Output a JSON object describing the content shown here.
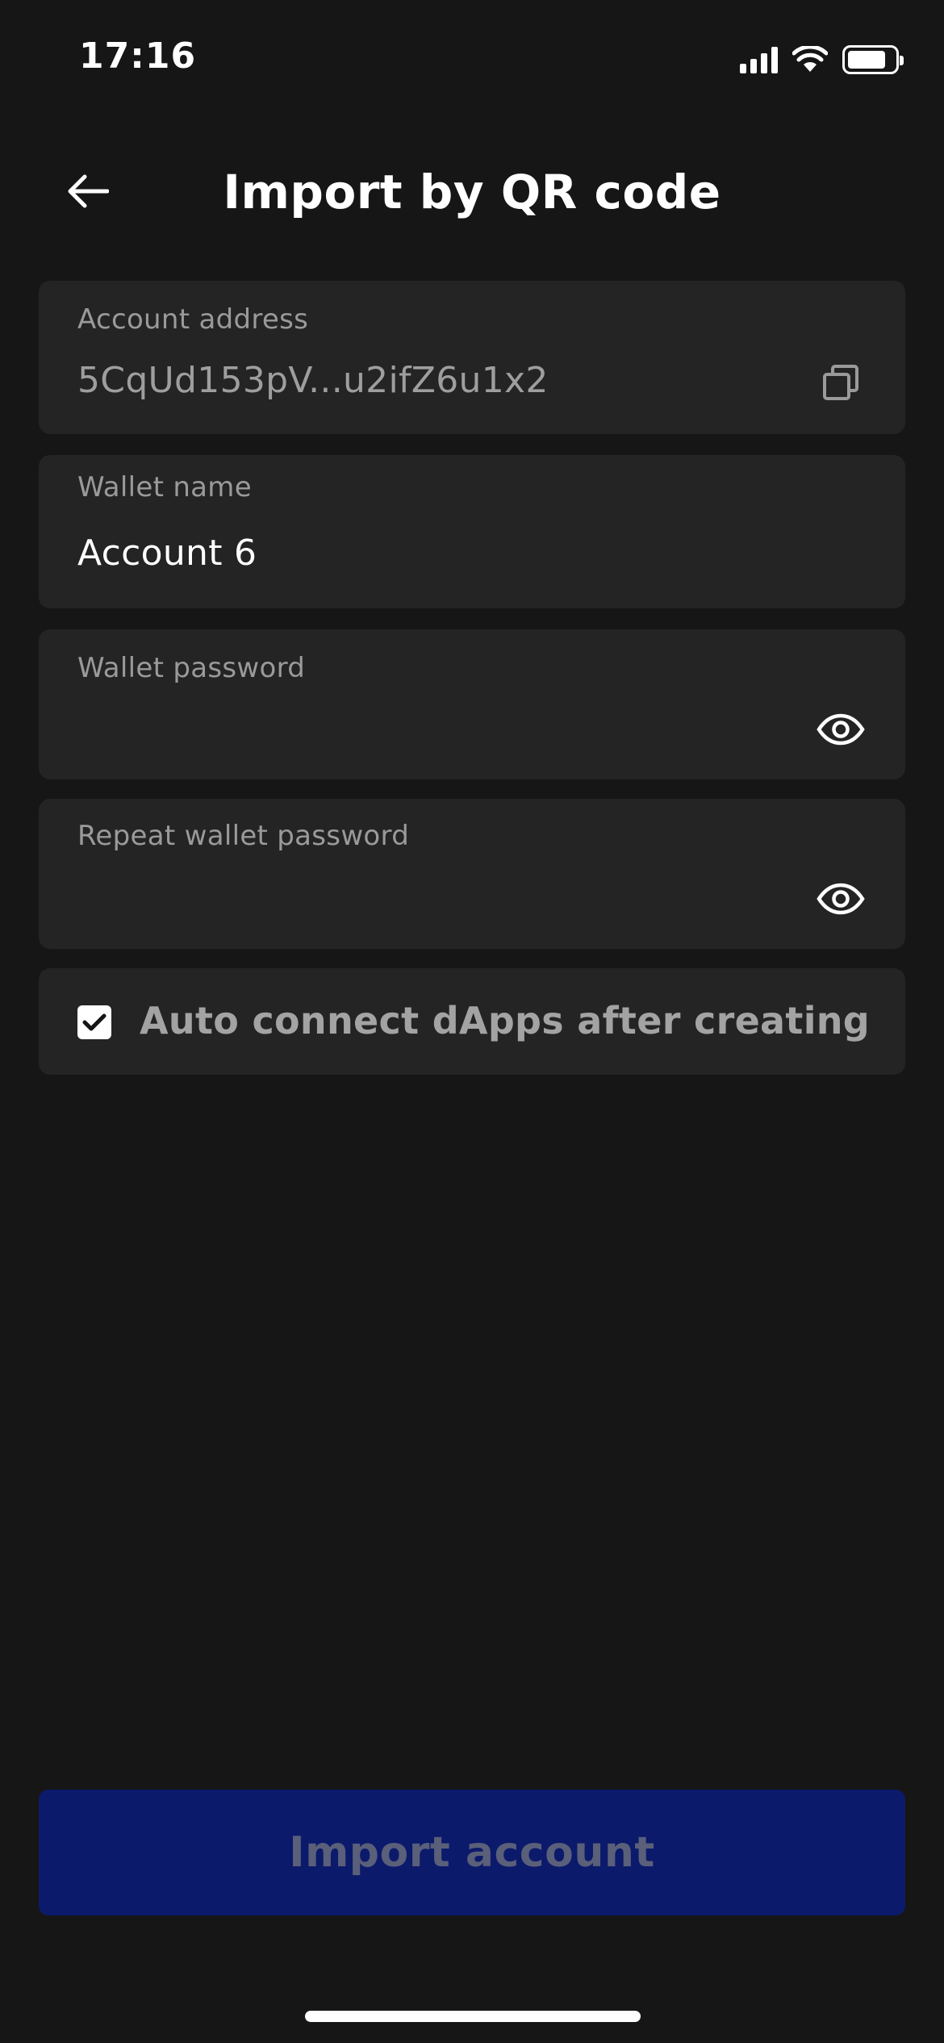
{
  "status_bar": {
    "time": "17:16",
    "icons": [
      "signal-icon",
      "wifi-icon",
      "battery-icon"
    ]
  },
  "header": {
    "back_icon": "arrow-left-icon",
    "title": "Import by QR code"
  },
  "fields": {
    "account_address": {
      "label": "Account address",
      "value": "5CqUd153pV...u2ifZ6u1x2",
      "icon": "copy-icon"
    },
    "wallet_name": {
      "label": "Wallet name",
      "value": "Account 6"
    },
    "wallet_password": {
      "label": "Wallet password",
      "value": "",
      "icon": "eye-icon"
    },
    "repeat_wallet_password": {
      "label": "Repeat wallet password",
      "value": "",
      "icon": "eye-icon"
    }
  },
  "auto_connect": {
    "label": "Auto connect dApps after creating",
    "checked": true
  },
  "import_button": {
    "label": "Import account",
    "disabled": true
  },
  "colors": {
    "background": "#161616",
    "card": "#242424",
    "button_bg_disabled": "#0c1a6b",
    "button_text_disabled": "#5a5f7a",
    "label_gray": "#9a9a9a"
  }
}
